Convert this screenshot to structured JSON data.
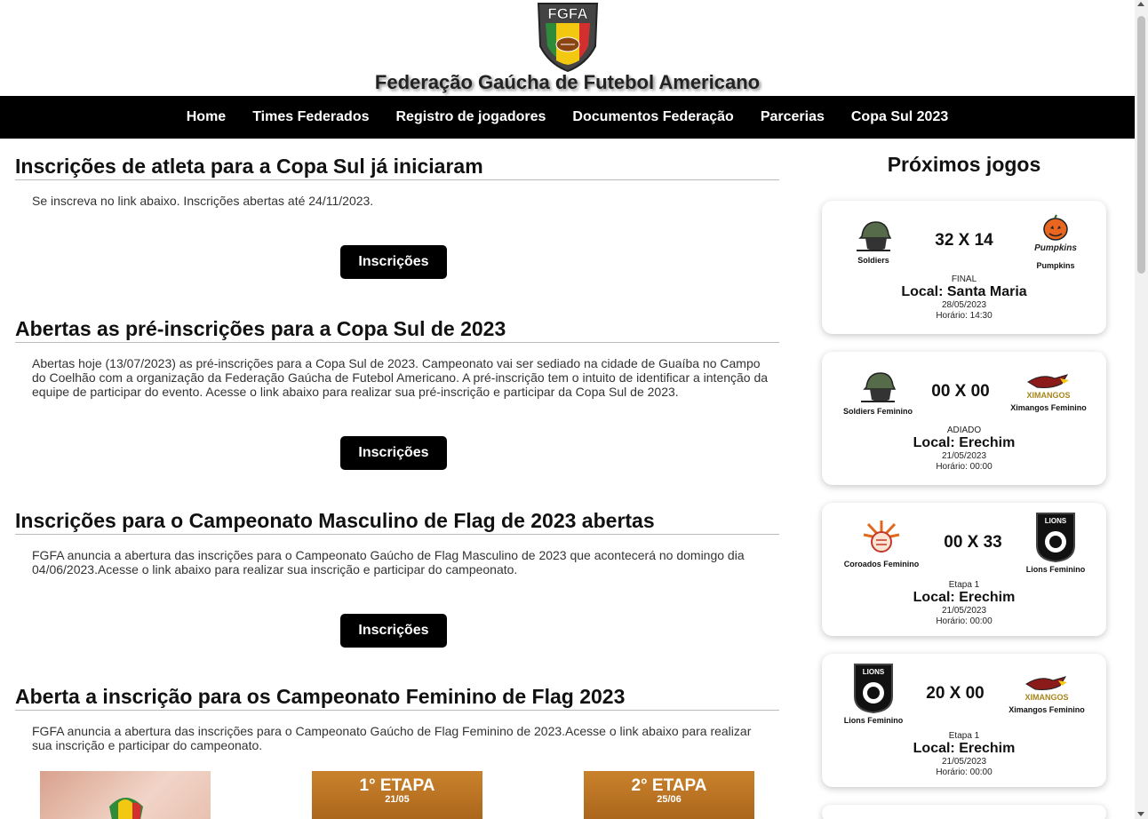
{
  "header": {
    "logo_text": "FGFA",
    "title": "Federação Gaúcha de Futebol Americano"
  },
  "nav": {
    "items": [
      "Home",
      "Times Federados",
      "Registro de jogadores",
      "Documentos Federação",
      "Parcerias",
      "Copa Sul 2023"
    ]
  },
  "posts": [
    {
      "title": "Inscrições de atleta para a Copa Sul já iniciaram",
      "body": "Se inscreva no link abaixo. Inscrições abertas até 24/11/2023.",
      "button": "Inscrições"
    },
    {
      "title": "Abertas as pré-inscrições para a Copa Sul de 2023",
      "body": "Abertas hoje (13/07/2023) as pré-inscrições para a Copa Sul de 2023. Campeonato vai ser sediado na cidade de Guaíba no Campo do Coelhão com a organização da Federação Gaúcha de Futebol Americano. A pré-inscrição tem o intuito de identificar a intenção da equipe de participar do evento. Acesse o link abaixo para realizar sua pré-inscrição e participar da Copa Sul de 2023.",
      "button": "Inscrições"
    },
    {
      "title": "Inscrições para o Campeonato Masculino de Flag de 2023 abertas",
      "body": "FGFA anuncia a abertura das inscrições para o Campeonato Gaúcho de Flag Masculino de 2023 que acontecerá no domingo dia 04/06/2023.Acesse o link abaixo para realizar sua inscrição e participar do campeonato.",
      "button": "Inscrições"
    },
    {
      "title": "Aberta a inscrição para os Campeonato Feminino de Flag 2023",
      "body": "FGFA anuncia a abertura das inscrições para o Campeonato Gaúcho de Flag Feminino de 2023.Acesse o link abaixo para realizar sua inscrição e participar do campeonato.",
      "thumbs": [
        {
          "etapa": "",
          "date": ""
        },
        {
          "etapa": "1° ETAPA",
          "date": "21/05"
        },
        {
          "etapa": "2° ETAPA",
          "date": "25/06"
        }
      ]
    }
  ],
  "sidebar": {
    "title": "Próximos jogos",
    "games": [
      {
        "home": "Soldiers",
        "away": "Pumpkins",
        "score": "32 X 14",
        "stage": "FINAL",
        "local": "Local: Santa Maria",
        "date": "28/05/2023",
        "time": "Horário: 14:30"
      },
      {
        "home": "Soldiers Feminino",
        "away": "Ximangos Feminino",
        "score": "00 X 00",
        "stage": "ADIADO",
        "local": "Local: Erechim",
        "date": "21/05/2023",
        "time": "Horário: 00:00"
      },
      {
        "home": "Coroados Feminino",
        "away": "Lions Feminino",
        "score": "00 X 33",
        "stage": "Etapa 1",
        "local": "Local: Erechim",
        "date": "21/05/2023",
        "time": "Horário: 00:00"
      },
      {
        "home": "Lions Feminino",
        "away": "Ximangos Feminino",
        "score": "20 X 00",
        "stage": "Etapa 1",
        "local": "Local: Erechim",
        "date": "21/05/2023",
        "time": "Horário: 00:00"
      }
    ]
  },
  "colors": {
    "nav_bg": "#000000",
    "button_bg": "#000000",
    "logo_green": "#2e8b3a",
    "logo_yellow": "#f2c811",
    "logo_red": "#d32f2f"
  }
}
